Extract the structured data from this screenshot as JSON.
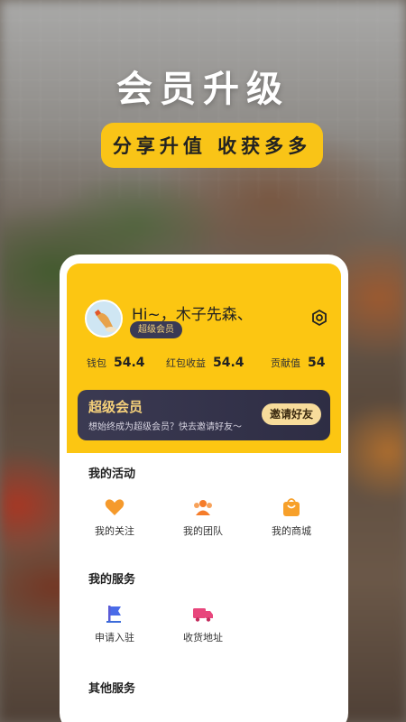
{
  "hero": {
    "title": "会员升级",
    "tagline": "分享升值 收获多多"
  },
  "profile": {
    "greeting": "Hi~，木子先森、",
    "level": "超级会员"
  },
  "stats": [
    {
      "label": "钱包",
      "value": "54.4"
    },
    {
      "label": "红包收益",
      "value": "54.4"
    },
    {
      "label": "贡献值",
      "value": "54"
    }
  ],
  "vip_banner": {
    "title": "超级会员",
    "subtitle": "想始终成为超级会员？快去邀请好友～",
    "button": "邀请好友"
  },
  "activities": {
    "title": "我的活动",
    "items": [
      {
        "label": "我的关注",
        "icon": "heart-icon"
      },
      {
        "label": "我的团队",
        "icon": "team-icon"
      },
      {
        "label": "我的商城",
        "icon": "shop-bag-icon"
      }
    ]
  },
  "services": {
    "title": "我的服务",
    "items": [
      {
        "label": "申请入驻",
        "icon": "flag-icon"
      },
      {
        "label": "收货地址",
        "icon": "truck-icon"
      }
    ]
  },
  "other": {
    "title": "其他服务"
  },
  "colors": {
    "accent": "#fcc612",
    "dark": "#3b3a52",
    "gold": "#f5d07a"
  }
}
